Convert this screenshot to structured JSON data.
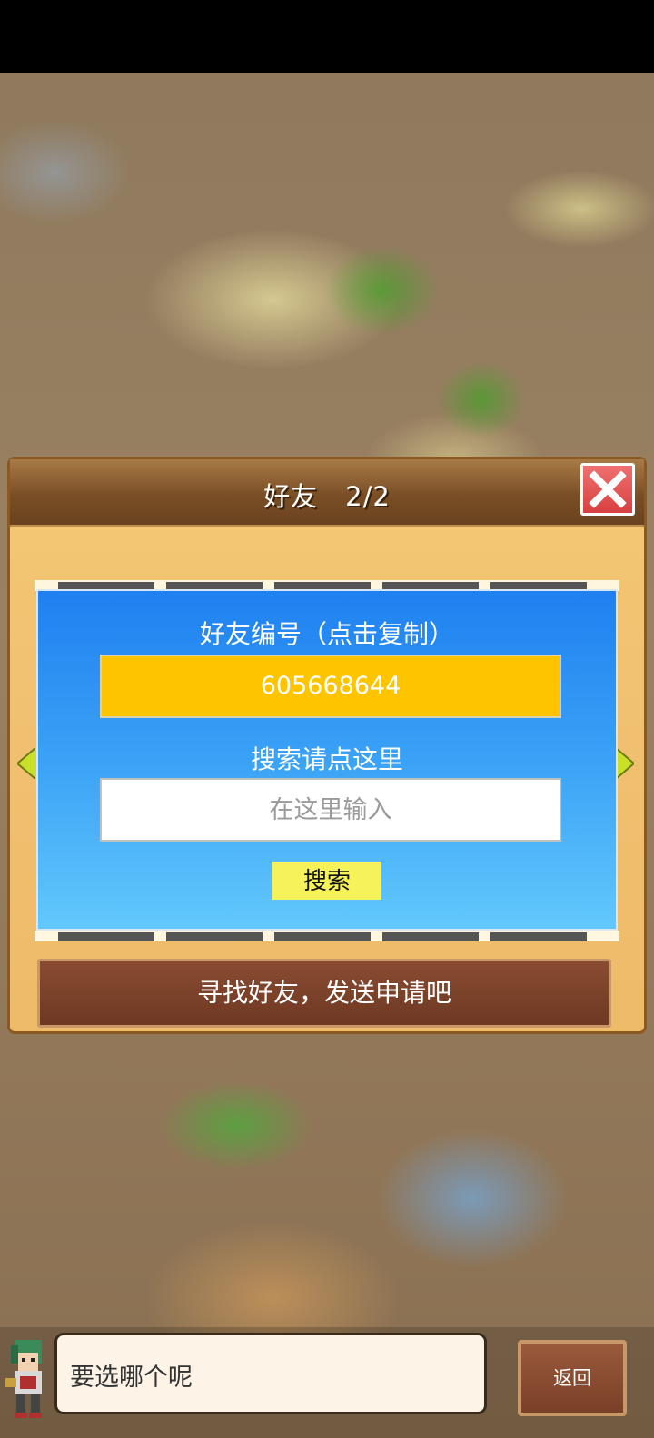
{
  "dialog": {
    "title": "好友　2/2",
    "friend_id_label": "好友编号（点击复制）",
    "friend_id_value": "605668644",
    "search_label": "搜索请点这里",
    "search_placeholder": "在这里输入",
    "search_button": "搜索",
    "find_friends_button": "寻找好友，发送申请吧",
    "close_icon": "close-x-icon",
    "page_arrow_icons": [
      "left-arrow-icon",
      "right-arrow-icon"
    ]
  },
  "footer": {
    "speech_text": "要选哪个呢",
    "back_button": "返回",
    "avatar_icon": "character-avatar"
  },
  "colors": {
    "panel_blue": "#1f80f0",
    "id_box_yellow": "#ffc400",
    "search_button_yellow": "#f6f35a",
    "dialog_wood": "#f0c070",
    "close_red": "#e05050"
  }
}
